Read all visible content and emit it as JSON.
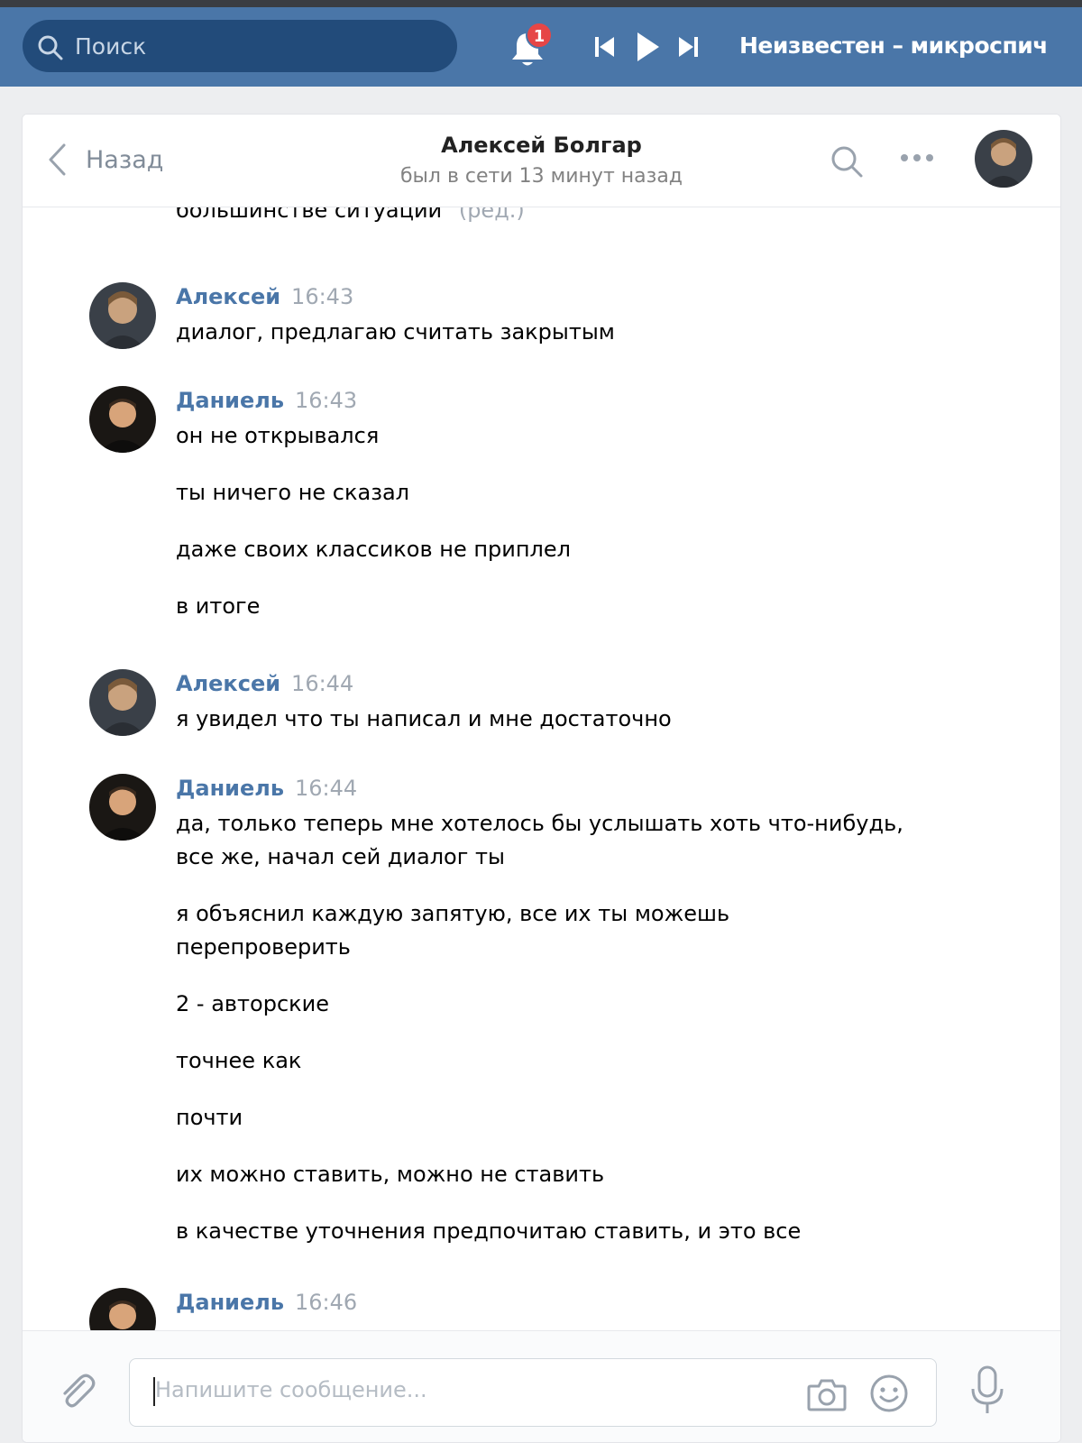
{
  "topbar": {
    "search_placeholder": "Поиск",
    "notifications_count": "1",
    "player_track": "Неизвестен – микроспич"
  },
  "chat_header": {
    "back_label": "Назад",
    "peer_name": "Алексей Болгар",
    "peer_status": "был в сети 13 минут назад"
  },
  "history": {
    "fragment_text": "большинстве ситуаций\"",
    "fragment_edited": "(ред.)",
    "groups": [
      {
        "author": "Алексей",
        "time": "16:43",
        "lines": [
          "диалог, предлагаю считать закрытым"
        ]
      },
      {
        "author": "Даниель",
        "time": "16:43",
        "lines": [
          "он не открывался",
          "ты ничего не сказал",
          "даже своих классиков не приплел",
          "в итоге"
        ]
      },
      {
        "author": "Алексей",
        "time": "16:44",
        "lines": [
          "я увидел что ты написал и мне достаточно"
        ]
      },
      {
        "author": "Даниель",
        "time": "16:44",
        "lines": [
          "да, только теперь мне хотелось бы услышать хоть что-нибудь, все же, начал сей диалог ты",
          "я объяснил каждую запятую, все их ты можешь перепроверить",
          "2 - авторские",
          "точнее как",
          "почти",
          "их можно ставить, можно не ставить",
          "в качестве уточнения предпочитаю ставить, и это все"
        ]
      },
      {
        "author": "Даниель",
        "time": "16:46",
        "lines": []
      }
    ]
  },
  "composer": {
    "placeholder": "Напишите сообщение..."
  },
  "colors": {
    "topbar": "#4a76a8",
    "search_bg": "#224b7a",
    "author_link": "#4a76a8",
    "badge": "#e64646",
    "page_bg": "#edeef0"
  },
  "icons": [
    "search-icon",
    "bell-icon",
    "prev-track-icon",
    "play-icon",
    "next-track-icon",
    "chevron-left-icon",
    "more-icon",
    "paperclip-icon",
    "camera-icon",
    "smile-icon",
    "mic-icon"
  ]
}
